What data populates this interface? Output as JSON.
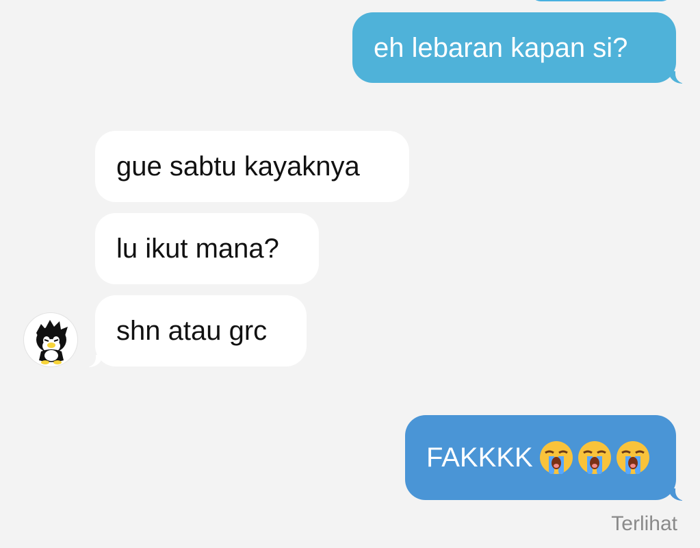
{
  "conversation": {
    "messages": [
      {
        "direction": "outgoing",
        "text": "eh lebaran kapan si?"
      },
      {
        "direction": "incoming",
        "text": "gue sabtu kayaknya"
      },
      {
        "direction": "incoming",
        "text": "lu ikut mana?"
      },
      {
        "direction": "incoming",
        "text": "shn atau grc"
      },
      {
        "direction": "outgoing",
        "text": "FAKKKK",
        "emojis": [
          "loudly-crying-face-emoji",
          "loudly-crying-face-emoji",
          "loudly-crying-face-emoji"
        ]
      }
    ],
    "read_status": "Terlihat"
  },
  "colors": {
    "background": "#f3f3f3",
    "outgoing_bubble_top": "#4fb2d9",
    "outgoing_bubble_bottom": "#4a95d6",
    "incoming_bubble": "#ffffff",
    "incoming_text": "#111111",
    "status_text": "#8a8a8a"
  },
  "icons": {
    "avatar": "penguin-avatar-icon"
  }
}
